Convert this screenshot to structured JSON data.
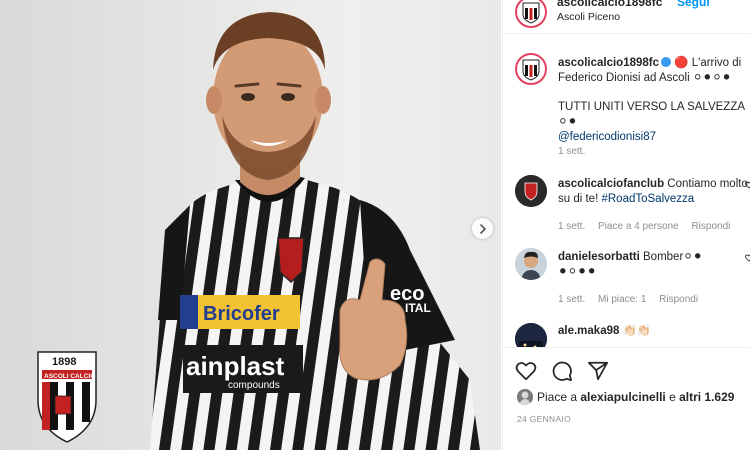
{
  "post": {
    "author": "ascolicalcio1898fc",
    "follow_label": "Segui",
    "location": "Ascoli Piceno"
  },
  "photo": {
    "jersey_sponsor": "Bricofer",
    "jersey_sponsor_2": "ainplast",
    "jersey_sponsor_2_sub": "compounds",
    "sleeve_sponsor": "eco",
    "sleeve_sponsor_sub": "ITAL",
    "logo_year": "1898",
    "logo_name": "ASCOLI CALCIO"
  },
  "caption": {
    "username": "ascolicalcio1898fc",
    "line1": " 🔴 L'arrivo di Federico Dionisi ad Ascoli ⚪⚫⚪⚫",
    "line2": "TUTTI UNITI VERSO LA SALVEZZA ⚪⚫",
    "mention": "@federicodionisi87",
    "time": "1 sett."
  },
  "comments": [
    {
      "username": "ascolicalciofanclub",
      "text": " Contiamo molto su di te! ",
      "hashtag": "#RoadToSalvezza",
      "time": "1 sett.",
      "likes": "Piace a 4 persone",
      "reply": "Rispondi"
    },
    {
      "username": "danielesorbatti",
      "text": " Bomber⚪⚫",
      "text2": "⚫⚪⚫⚫",
      "time": "1 sett.",
      "likes": "Mi piace: 1",
      "reply": "Rispondi"
    },
    {
      "username": "ale.maka98",
      "text": " 👏🏻👏🏻"
    }
  ],
  "likes_summary": {
    "prefix": "Piace a ",
    "user": "alexiapulcinelli",
    "middle": " e ",
    "others": "altri 1.629"
  },
  "date": "24 GENNAIO",
  "icons": [
    "heart-icon",
    "comment-icon",
    "share-icon",
    "chevron-right-icon",
    "verified-icon"
  ],
  "colors": {
    "accent": "#0095f6",
    "ring": "#e4405f",
    "meta": "#8e8e8e"
  }
}
